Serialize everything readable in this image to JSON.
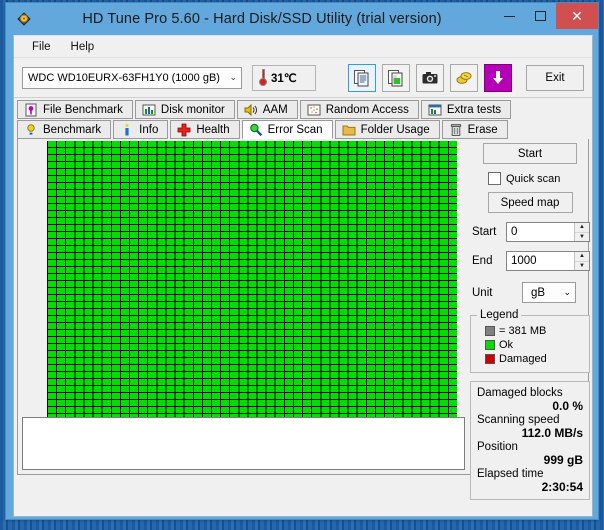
{
  "window": {
    "title": "HD Tune Pro 5.60 - Hard Disk/SSD Utility (trial version)",
    "app_icon": "hdd-diamond-icon",
    "minimize_label": "Minimize",
    "maximize_label": "Maximize",
    "close_label": "✕",
    "titlebar_color": "#62a8dd",
    "close_button_color": "#d05052"
  },
  "menu": {
    "items": [
      {
        "label": "File"
      },
      {
        "label": "Help"
      }
    ]
  },
  "toolbar": {
    "drive": {
      "selected": "WDC WD10EURX-63FH1Y0 (1000 gB)",
      "chevron": "⌄"
    },
    "temperature": {
      "value": "31℃",
      "icon": "thermometer-icon"
    },
    "buttons": [
      {
        "name": "copy-report-icon",
        "selected": true
      },
      {
        "name": "copy-graph-icon",
        "selected": false
      },
      {
        "name": "screenshot-camera-icon",
        "selected": false
      },
      {
        "name": "coins-icon",
        "selected": false
      },
      {
        "name": "download-arrow-icon",
        "selected": false,
        "color": "#b500b5"
      }
    ],
    "exit_label": "Exit"
  },
  "tabs": {
    "row1": [
      {
        "label": "File Benchmark",
        "icon": "file-benchmark-icon",
        "active": false
      },
      {
        "label": "Disk monitor",
        "icon": "disk-monitor-icon",
        "active": false
      },
      {
        "label": "AAM",
        "icon": "speaker-icon",
        "active": false
      },
      {
        "label": "Random Access",
        "icon": "random-access-icon",
        "active": false
      },
      {
        "label": "Extra tests",
        "icon": "extra-tests-icon",
        "active": false
      }
    ],
    "row2": [
      {
        "label": "Benchmark",
        "icon": "lightbulb-icon",
        "active": false
      },
      {
        "label": "Info",
        "icon": "info-icon",
        "active": false
      },
      {
        "label": "Health",
        "icon": "health-cross-icon",
        "active": false
      },
      {
        "label": "Error Scan",
        "icon": "magnifier-icon",
        "active": true
      },
      {
        "label": "Folder Usage",
        "icon": "folder-icon",
        "active": false
      },
      {
        "label": "Erase",
        "icon": "trash-icon",
        "active": false
      }
    ]
  },
  "scan": {
    "start_button": "Start",
    "quick_scan_label": "Quick scan",
    "quick_scan_checked": false,
    "speed_map_button": "Speed map",
    "start_field": {
      "label": "Start",
      "value": "0"
    },
    "end_field": {
      "label": "End",
      "value": "1000"
    },
    "unit": {
      "label": "Unit",
      "value": "gB",
      "chevron": "⌄"
    }
  },
  "legend": {
    "title": "Legend",
    "block_size": "= 381 MB",
    "block_color": "#808080",
    "ok_label": "Ok",
    "ok_color": "#00e000",
    "damaged_label": "Damaged",
    "damaged_color": "#d00000"
  },
  "stats": {
    "damaged_blocks_label": "Damaged blocks",
    "damaged_blocks_value": "0.0 %",
    "scanning_speed_label": "Scanning speed",
    "scanning_speed_value": "112.0 MB/s",
    "position_label": "Position",
    "position_value": "999 gB",
    "elapsed_time_label": "Elapsed time",
    "elapsed_time_value": "2:30:54"
  },
  "grid": {
    "columns": 45,
    "rows": 44,
    "block_color": "#00e000",
    "gridline_color": "#000000",
    "all_ok": true
  },
  "log": {
    "text": ""
  }
}
